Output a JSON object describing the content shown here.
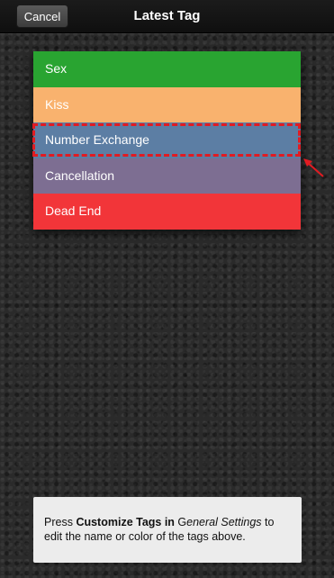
{
  "navbar": {
    "cancel_label": "Cancel",
    "title": "Latest Tag"
  },
  "tags": [
    {
      "label": "Sex",
      "color": "#29a431"
    },
    {
      "label": "Kiss",
      "color": "#f9b26e"
    },
    {
      "label": "Number Exchange",
      "color": "#5c7ea4"
    },
    {
      "label": "Cancellation",
      "color": "#7d6e92"
    },
    {
      "label": "Dead End",
      "color": "#f23539"
    }
  ],
  "highlight": {
    "target": "Number Exchange",
    "color": "#e11b22",
    "arrow_icon": "arrow-pointer-icon"
  },
  "info": {
    "part1": "Press ",
    "part2_bold": "Customize Tags in",
    "part3": " G",
    "part4_italic": "eneral Settings",
    "part5": " to",
    "line2": "edit the name or color of the tags above."
  }
}
